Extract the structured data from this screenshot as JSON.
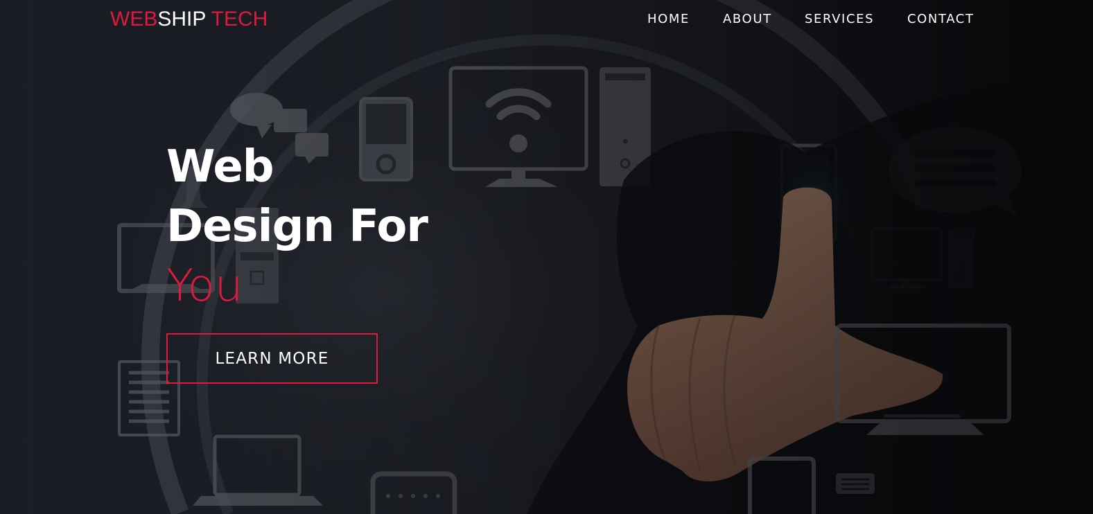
{
  "brand": {
    "part1": "WEB",
    "part2": "SHIP",
    "part3": "TECH",
    "accent_color": "#e0193f"
  },
  "nav": {
    "items": [
      {
        "label": "HOME"
      },
      {
        "label": "ABOUT"
      },
      {
        "label": "SERVICES"
      },
      {
        "label": "CONTACT"
      }
    ]
  },
  "hero": {
    "line1": "Web",
    "line2": "Design For",
    "line3": "You",
    "cta_label": "LEARN MORE",
    "background_icons": [
      "chat-bubbles-icon",
      "mp3-player-icon",
      "wifi-monitor-icon",
      "pc-tower-icon",
      "tablet-icon",
      "message-bubble-icon",
      "desktop-computer-icon",
      "document-icon",
      "laptop-icon",
      "tv-monitor-icon",
      "phone-icon",
      "pointing-hand"
    ]
  },
  "colors": {
    "background": "#1c1f27",
    "accent": "#e0193f",
    "text": "#ffffff"
  }
}
